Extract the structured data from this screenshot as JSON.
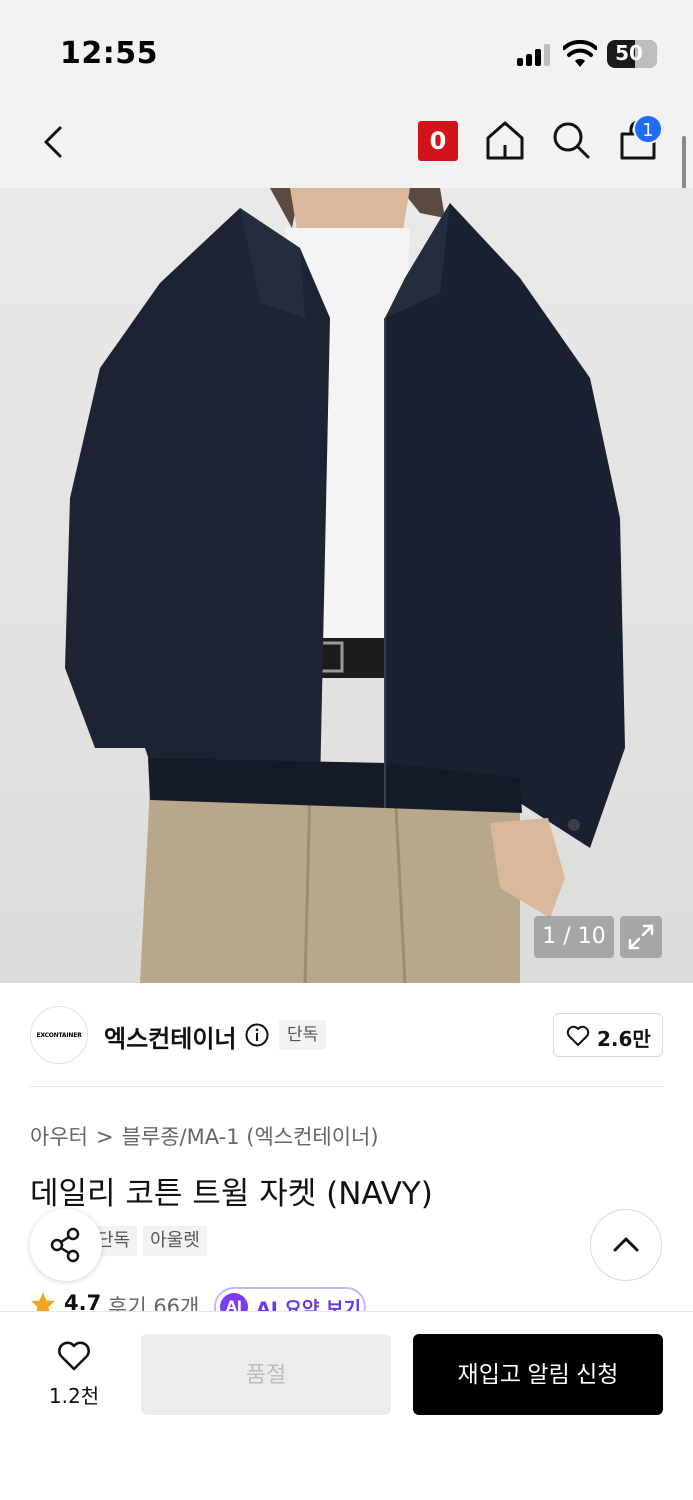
{
  "status_bar": {
    "time": "12:55",
    "battery": "50"
  },
  "nav": {
    "recent_badge": "0",
    "cart_count": "1"
  },
  "gallery": {
    "counter": "1 / 10"
  },
  "brand": {
    "logo_text": "EXCONTAINER",
    "name": "엑스컨테이너",
    "exclusive_tag": "단독",
    "likes": "2.6만"
  },
  "breadcrumb": {
    "level1": "아우터",
    "separator": ">",
    "level2": "블루종/MA-1 (엑스컨테이너)"
  },
  "product": {
    "title": "데일리 코튼 트윌 자켓 (NAVY)",
    "tags": [
      "단독",
      "아울렛"
    ],
    "rating": "4.7",
    "reviews": "후기 66개",
    "ai_badge": "AI",
    "ai_summary": "AI 요약 보기"
  },
  "bottom_bar": {
    "wish_count": "1.2천",
    "soldout_label": "품절",
    "restock_label": "재입고 알림 신청"
  },
  "colors": {
    "brand_red": "#d3131b",
    "cart_blue": "#1f6cf6",
    "ai_purple": "#7b3cf2",
    "star": "#f4a623"
  },
  "icons": [
    "back-icon",
    "home-icon",
    "search-icon",
    "cart-icon",
    "expand-icon",
    "info-icon",
    "heart-icon",
    "share-icon",
    "chevron-up-icon",
    "star-icon"
  ]
}
